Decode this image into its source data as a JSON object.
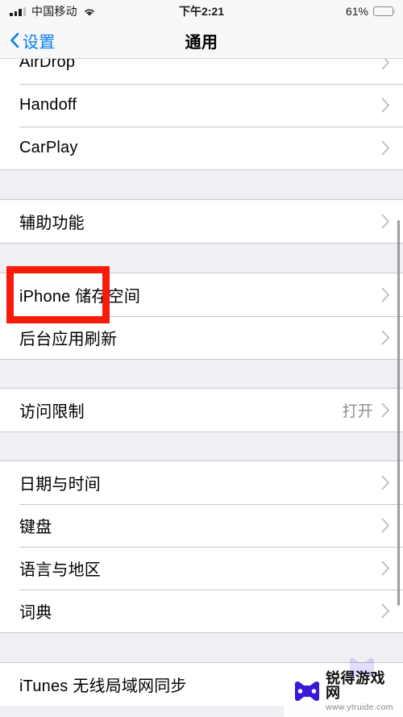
{
  "status_bar": {
    "carrier": "中国移动",
    "signal_bars_filled": 3,
    "signal_bars_total": 4,
    "wifi_icon": "wifi-icon",
    "time": "下午2:21",
    "battery_percent_label": "61%",
    "battery_percent": 61
  },
  "nav": {
    "back_label": "设置",
    "back_icon": "chevron-left-icon",
    "title": "通用"
  },
  "colors": {
    "tint": "#0a7cf0",
    "group_background": "#ffffff",
    "page_background": "#efeff4",
    "separator": "#c8c7cc",
    "secondary_text": "#8e8e93",
    "highlight_box": "#f81b09",
    "watermark_mark": "#3b17d8"
  },
  "list": {
    "groups": [
      {
        "id": "connectivity",
        "clipped_top": true,
        "rows": [
          {
            "label": "AirDrop",
            "value": "",
            "accessory": "chevron-right-icon"
          },
          {
            "label": "Handoff",
            "value": "",
            "accessory": "chevron-right-icon"
          },
          {
            "label": "CarPlay",
            "value": "",
            "accessory": "chevron-right-icon"
          }
        ]
      },
      {
        "id": "accessibility",
        "highlighted": true,
        "rows": [
          {
            "label": "辅助功能",
            "value": "",
            "accessory": "chevron-right-icon"
          }
        ]
      },
      {
        "id": "storage",
        "rows": [
          {
            "label": "iPhone 储存空间",
            "value": "",
            "accessory": "chevron-right-icon"
          },
          {
            "label": "后台应用刷新",
            "value": "",
            "accessory": "chevron-right-icon"
          }
        ]
      },
      {
        "id": "restrictions",
        "rows": [
          {
            "label": "访问限制",
            "value": "打开",
            "accessory": "chevron-right-icon"
          }
        ]
      },
      {
        "id": "locale",
        "rows": [
          {
            "label": "日期与时间",
            "value": "",
            "accessory": "chevron-right-icon"
          },
          {
            "label": "键盘",
            "value": "",
            "accessory": "chevron-right-icon"
          },
          {
            "label": "语言与地区",
            "value": "",
            "accessory": "chevron-right-icon"
          },
          {
            "label": "词典",
            "value": "",
            "accessory": "chevron-right-icon"
          }
        ]
      },
      {
        "id": "itunes-sync",
        "clipped_bottom": true,
        "rows": [
          {
            "label": "iTunes 无线局域网同步",
            "value": "",
            "accessory": "chevron-right-icon"
          }
        ]
      }
    ]
  },
  "watermark": {
    "name": "锐得游戏网",
    "url": "www.ytruide.com",
    "mark_icon": "gamepad-bowtie-icon"
  }
}
